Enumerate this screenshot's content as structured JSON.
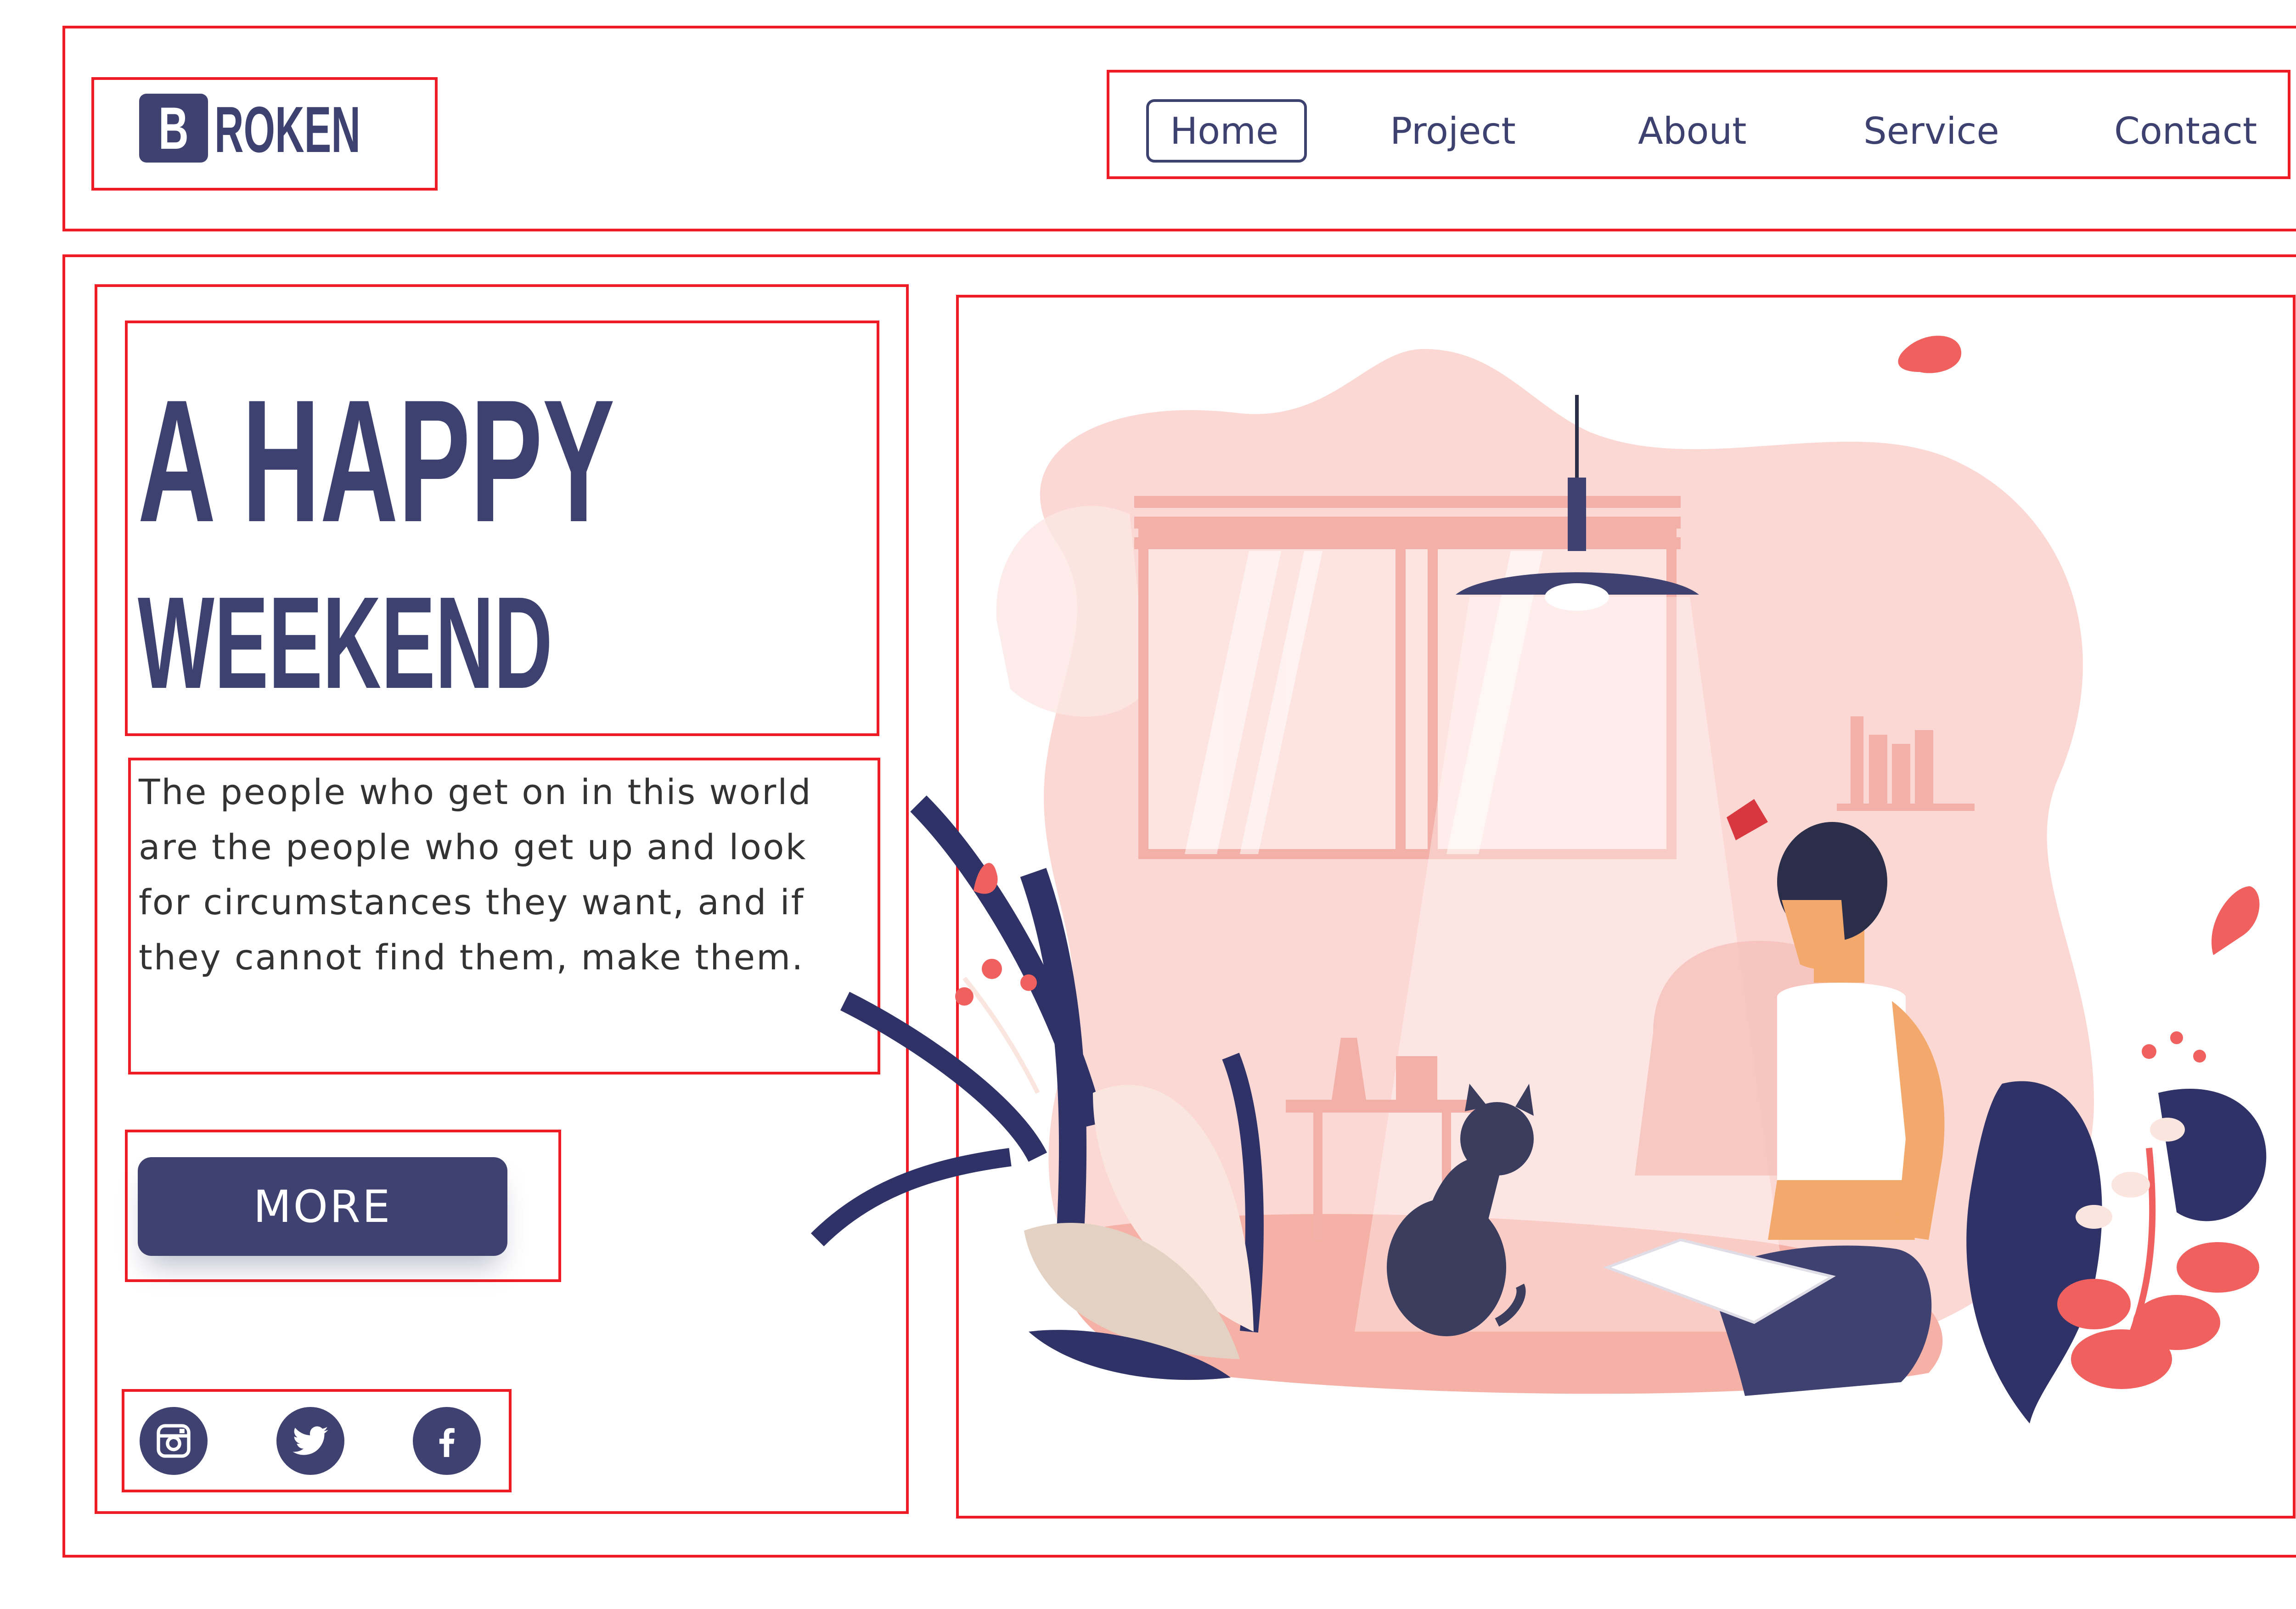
{
  "brand": {
    "logo_letter": "B",
    "logo_rest": "ROKEN"
  },
  "nav": {
    "items": [
      {
        "label": "Home",
        "active": true
      },
      {
        "label": "Project",
        "active": false
      },
      {
        "label": "About",
        "active": false
      },
      {
        "label": "Service",
        "active": false
      },
      {
        "label": "Contact",
        "active": false
      }
    ]
  },
  "hero": {
    "title_line1": "A HAPPY",
    "title_line2": "WEEKEND",
    "body_lines": [
      "The people who get on in this world",
      "are the people who get up and look",
      "for circumstances they want, and if",
      "they cannot find them, make them."
    ],
    "button_label": "MORE"
  },
  "social": [
    {
      "icon": "instagram-icon"
    },
    {
      "icon": "twitter-icon"
    },
    {
      "icon": "facebook-icon"
    }
  ],
  "colors": {
    "primary": "#3f4270",
    "annotation": "#ee1c24",
    "illustration_pink": "#f9cdca",
    "accent_red": "#f0605f"
  }
}
